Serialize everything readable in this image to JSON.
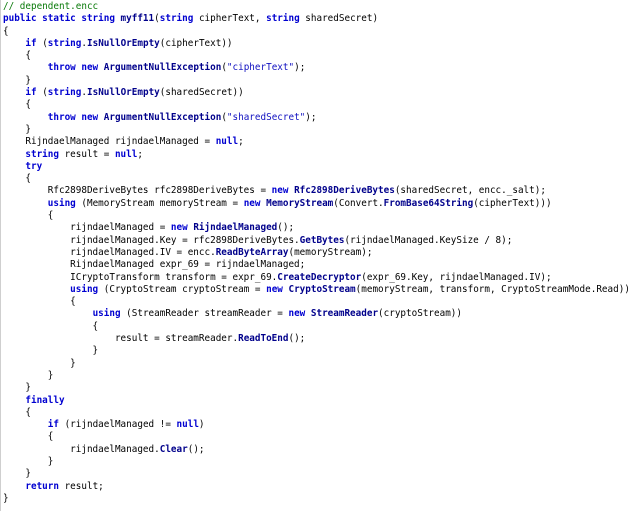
{
  "editor": {
    "lines": [
      [
        [
          "cm",
          "// dependent.encc"
        ]
      ],
      [
        [
          "kw",
          "public static string "
        ],
        [
          "fn",
          "myff11"
        ],
        [
          "plain",
          "("
        ],
        [
          "kw",
          "string "
        ],
        [
          "plain",
          "cipherText, "
        ],
        [
          "kw",
          "string "
        ],
        [
          "plain",
          "sharedSecret)"
        ]
      ],
      [
        [
          "plain",
          "{"
        ]
      ],
      [
        [
          "plain",
          "    "
        ],
        [
          "kw",
          "if "
        ],
        [
          "plain",
          "("
        ],
        [
          "kw",
          "string"
        ],
        [
          "plain",
          "."
        ],
        [
          "fn",
          "IsNullOrEmpty"
        ],
        [
          "plain",
          "(cipherText))"
        ]
      ],
      [
        [
          "plain",
          "    {"
        ]
      ],
      [
        [
          "plain",
          "        "
        ],
        [
          "kw",
          "throw new "
        ],
        [
          "fn",
          "ArgumentNullException"
        ],
        [
          "plain",
          "("
        ],
        [
          "str",
          "\"cipherText\""
        ],
        [
          "plain",
          ");"
        ]
      ],
      [
        [
          "plain",
          "    }"
        ]
      ],
      [
        [
          "plain",
          "    "
        ],
        [
          "kw",
          "if "
        ],
        [
          "plain",
          "("
        ],
        [
          "kw",
          "string"
        ],
        [
          "plain",
          "."
        ],
        [
          "fn",
          "IsNullOrEmpty"
        ],
        [
          "plain",
          "(sharedSecret))"
        ]
      ],
      [
        [
          "plain",
          "    {"
        ]
      ],
      [
        [
          "plain",
          "        "
        ],
        [
          "kw",
          "throw new "
        ],
        [
          "fn",
          "ArgumentNullException"
        ],
        [
          "plain",
          "("
        ],
        [
          "str",
          "\"sharedSecret\""
        ],
        [
          "plain",
          ");"
        ]
      ],
      [
        [
          "plain",
          "    }"
        ]
      ],
      [
        [
          "plain",
          "    RijndaelManaged rijndaelManaged = "
        ],
        [
          "kw",
          "null"
        ],
        [
          "plain",
          ";"
        ]
      ],
      [
        [
          "plain",
          "    "
        ],
        [
          "kw",
          "string "
        ],
        [
          "plain",
          "result = "
        ],
        [
          "kw",
          "null"
        ],
        [
          "plain",
          ";"
        ]
      ],
      [
        [
          "plain",
          "    "
        ],
        [
          "kw",
          "try"
        ]
      ],
      [
        [
          "plain",
          "    {"
        ]
      ],
      [
        [
          "plain",
          "        Rfc2898DeriveBytes rfc2898DeriveBytes = "
        ],
        [
          "kw",
          "new "
        ],
        [
          "fn",
          "Rfc2898DeriveBytes"
        ],
        [
          "plain",
          "(sharedSecret, encc._salt);"
        ]
      ],
      [
        [
          "plain",
          "        "
        ],
        [
          "kw",
          "using "
        ],
        [
          "plain",
          "(MemoryStream memoryStream = "
        ],
        [
          "kw",
          "new "
        ],
        [
          "fn",
          "MemoryStream"
        ],
        [
          "plain",
          "(Convert."
        ],
        [
          "fn",
          "FromBase64String"
        ],
        [
          "plain",
          "(cipherText)))"
        ]
      ],
      [
        [
          "plain",
          "        {"
        ]
      ],
      [
        [
          "plain",
          "            rijndaelManaged = "
        ],
        [
          "kw",
          "new "
        ],
        [
          "fn",
          "RijndaelManaged"
        ],
        [
          "plain",
          "();"
        ]
      ],
      [
        [
          "plain",
          "            rijndaelManaged.Key = rfc2898DeriveBytes."
        ],
        [
          "fn",
          "GetBytes"
        ],
        [
          "plain",
          "(rijndaelManaged.KeySize / 8);"
        ]
      ],
      [
        [
          "plain",
          "            rijndaelManaged.IV = encc."
        ],
        [
          "fn",
          "ReadByteArray"
        ],
        [
          "plain",
          "(memoryStream);"
        ]
      ],
      [
        [
          "plain",
          "            RijndaelManaged expr_69 = rijndaelManaged;"
        ]
      ],
      [
        [
          "plain",
          "            ICryptoTransform transform = expr_69."
        ],
        [
          "fn",
          "CreateDecryptor"
        ],
        [
          "plain",
          "(expr_69.Key, rijndaelManaged.IV);"
        ]
      ],
      [
        [
          "plain",
          "            "
        ],
        [
          "kw",
          "using "
        ],
        [
          "plain",
          "(CryptoStream cryptoStream = "
        ],
        [
          "kw",
          "new "
        ],
        [
          "fn",
          "CryptoStream"
        ],
        [
          "plain",
          "(memoryStream, transform, CryptoStreamMode.Read))"
        ]
      ],
      [
        [
          "plain",
          "            {"
        ]
      ],
      [
        [
          "plain",
          "                "
        ],
        [
          "kw",
          "using "
        ],
        [
          "plain",
          "(StreamReader streamReader = "
        ],
        [
          "kw",
          "new "
        ],
        [
          "fn",
          "StreamReader"
        ],
        [
          "plain",
          "(cryptoStream))"
        ]
      ],
      [
        [
          "plain",
          "                {"
        ]
      ],
      [
        [
          "plain",
          "                    result = streamReader."
        ],
        [
          "fn",
          "ReadToEnd"
        ],
        [
          "plain",
          "();"
        ]
      ],
      [
        [
          "plain",
          "                }"
        ]
      ],
      [
        [
          "plain",
          "            }"
        ]
      ],
      [
        [
          "plain",
          "        }"
        ]
      ],
      [
        [
          "plain",
          "    }"
        ]
      ],
      [
        [
          "plain",
          "    "
        ],
        [
          "kw",
          "finally"
        ]
      ],
      [
        [
          "plain",
          "    {"
        ]
      ],
      [
        [
          "plain",
          "        "
        ],
        [
          "kw",
          "if "
        ],
        [
          "plain",
          "(rijndaelManaged != "
        ],
        [
          "kw",
          "null"
        ],
        [
          "plain",
          ")"
        ]
      ],
      [
        [
          "plain",
          "        {"
        ]
      ],
      [
        [
          "plain",
          "            rijndaelManaged."
        ],
        [
          "fn",
          "Clear"
        ],
        [
          "plain",
          "();"
        ]
      ],
      [
        [
          "plain",
          "        }"
        ]
      ],
      [
        [
          "plain",
          "    }"
        ]
      ],
      [
        [
          "plain",
          "    "
        ],
        [
          "kw",
          "return "
        ],
        [
          "plain",
          "result;"
        ]
      ],
      [
        [
          "plain",
          "}"
        ]
      ]
    ]
  }
}
